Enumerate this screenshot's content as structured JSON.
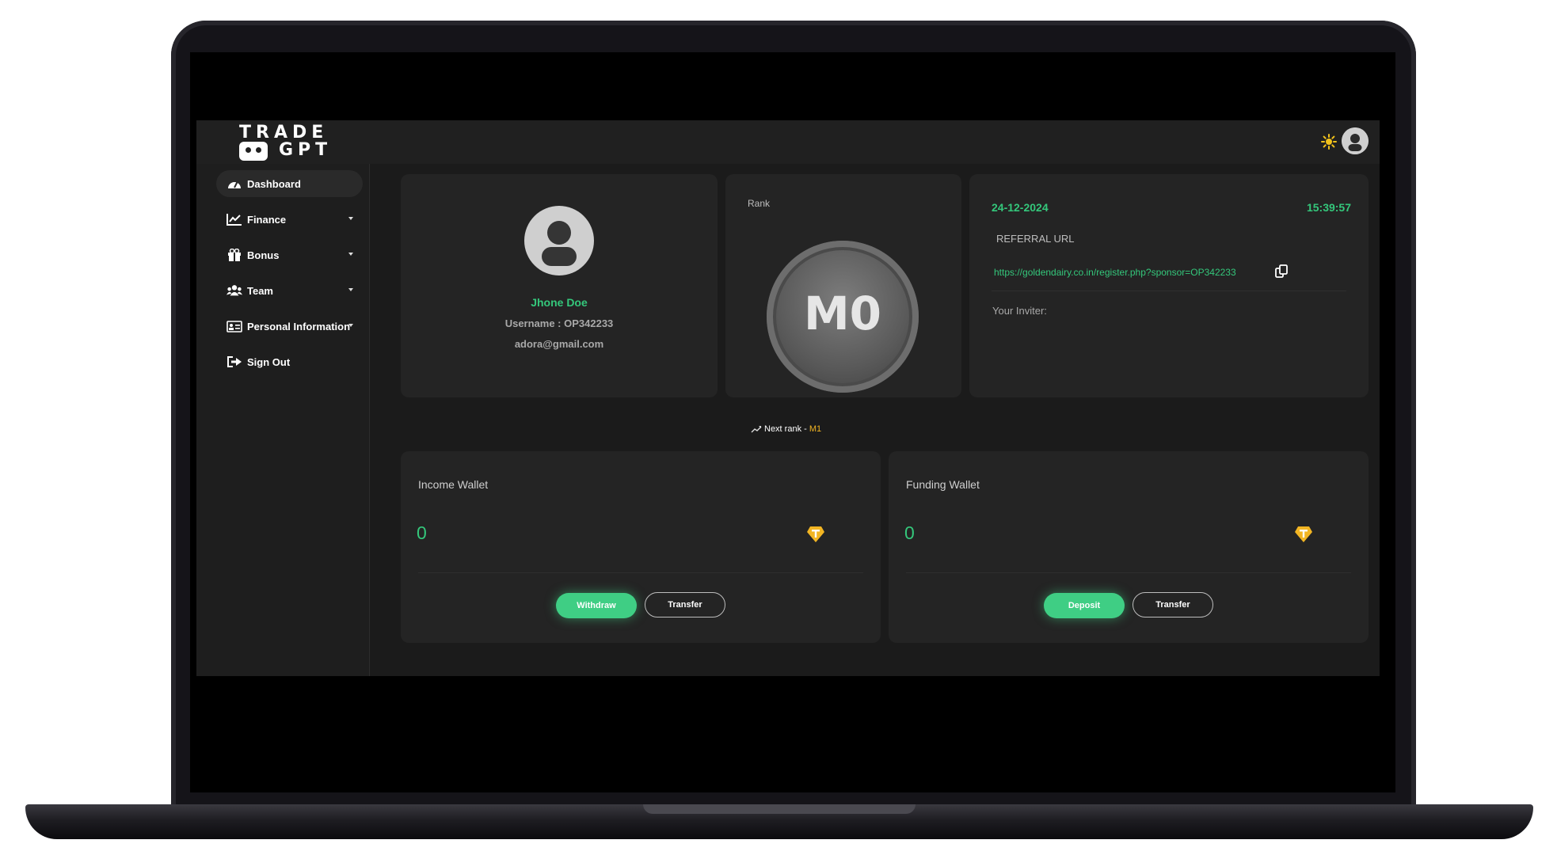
{
  "brand": {
    "logo_line1": "TRADE",
    "logo_line2": "GPT"
  },
  "header": {
    "theme_icon": "sun-icon",
    "avatar_icon": "user-icon"
  },
  "sidebar": {
    "items": [
      {
        "label": "Dashboard",
        "icon": "dashboard-icon",
        "active": true
      },
      {
        "label": "Finance",
        "icon": "chart-line-icon",
        "has_submenu": true
      },
      {
        "label": "Bonus",
        "icon": "gift-icon",
        "has_submenu": true
      },
      {
        "label": "Team",
        "icon": "users-icon",
        "has_submenu": true
      },
      {
        "label": "Personal Information",
        "icon": "id-card-icon",
        "has_submenu": true
      },
      {
        "label": "Sign Out",
        "icon": "sign-out-icon"
      }
    ]
  },
  "profile": {
    "name": "Jhone Doe",
    "username": "Username : OP342233",
    "email": "adora@gmail.com"
  },
  "rank": {
    "title": "Rank",
    "badge": "M0",
    "next_label": "Next rank -",
    "next_value": "M1"
  },
  "info": {
    "date": "24-12-2024",
    "time": "15:39:57",
    "referral_label": "REFERRAL URL",
    "referral_url": "https://goldendairy.co.in/register.php?sponsor=OP342233",
    "inviter_label": "Your Inviter:"
  },
  "wallets": {
    "income": {
      "title": "Income Wallet",
      "amount": "0",
      "primary": "Withdraw",
      "secondary": "Transfer"
    },
    "funding": {
      "title": "Funding Wallet",
      "amount": "0",
      "primary": "Deposit",
      "secondary": "Transfer"
    }
  },
  "colors": {
    "accent": "#34c77b",
    "gold": "#f2b523",
    "bg": "#1b1b1b",
    "card": "#242424"
  }
}
